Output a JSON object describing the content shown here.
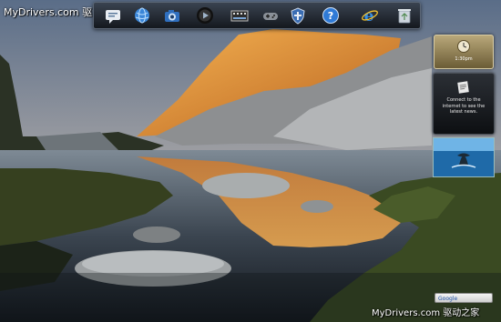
{
  "watermarks": {
    "top": "MyDrivers.com 驱动之家",
    "bottom": "MyDrivers.com 驱动之家"
  },
  "launcher": {
    "items": [
      {
        "name": "chat-icon"
      },
      {
        "name": "globe-icon"
      },
      {
        "name": "camera-icon"
      },
      {
        "name": "media-player-icon"
      },
      {
        "name": "film-icon"
      },
      {
        "name": "game-icon"
      },
      {
        "name": "shield-icon"
      },
      {
        "name": "help-icon"
      },
      {
        "name": "internet-explorer-icon"
      },
      {
        "name": "recycle-bin-icon"
      }
    ]
  },
  "sidebar": {
    "clock": {
      "time": "1:30pm"
    },
    "news": {
      "message": "Connect to the internet to see the latest news."
    },
    "search": {
      "placeholder": "Google"
    }
  },
  "colors": {
    "sky_top": "#5c6f8a",
    "sky_bottom": "#e6c59a",
    "mountain_lit": "#e9953b",
    "water": "#20262f"
  }
}
